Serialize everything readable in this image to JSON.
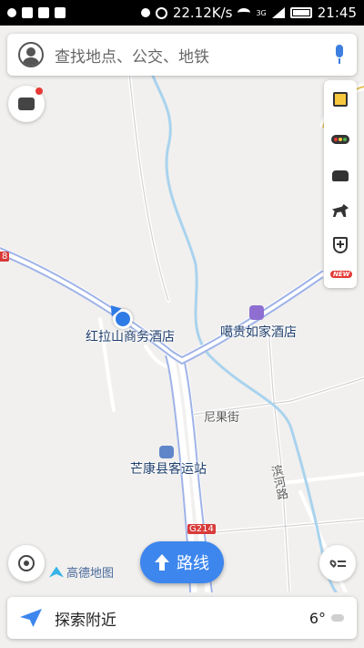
{
  "status_bar": {
    "network_speed": "22.12K/s",
    "signal_label": "3G",
    "time": "21:45"
  },
  "search": {
    "placeholder": "查找地点、公交、地铁"
  },
  "map": {
    "labels": {
      "hotel_red": "红拉山商务酒店",
      "hotel_ga": "噶贵如家酒店",
      "street_niguo": "尼果街",
      "bus_station": "芒康县客运站",
      "road_binhe": "滨河路",
      "road_g214": "G214",
      "edge_shield": "8"
    }
  },
  "tools": {
    "new_badge": "NEW"
  },
  "route_button": {
    "label": "路线"
  },
  "brand": {
    "name": "高德地图"
  },
  "bottom_bar": {
    "explore_label": "探索附近",
    "temperature": "6°"
  },
  "colors": {
    "accent_blue": "#3d86ee",
    "river": "#a9d3ee",
    "road_main": "#9fb3e8",
    "location_dot": "#2f7be6",
    "badge_red": "#e53935"
  },
  "icons": {
    "status_left": [
      "location-icon",
      "grid-icon",
      "image-icon",
      "image-icon"
    ],
    "status_right": [
      "location-icon",
      "alarm-icon",
      "wifi-icon",
      "signal-icon",
      "battery-icon"
    ],
    "tools": [
      "layers-icon",
      "traffic-light-icon",
      "taxi-icon",
      "horse-icon",
      "shield-plus-icon"
    ]
  }
}
